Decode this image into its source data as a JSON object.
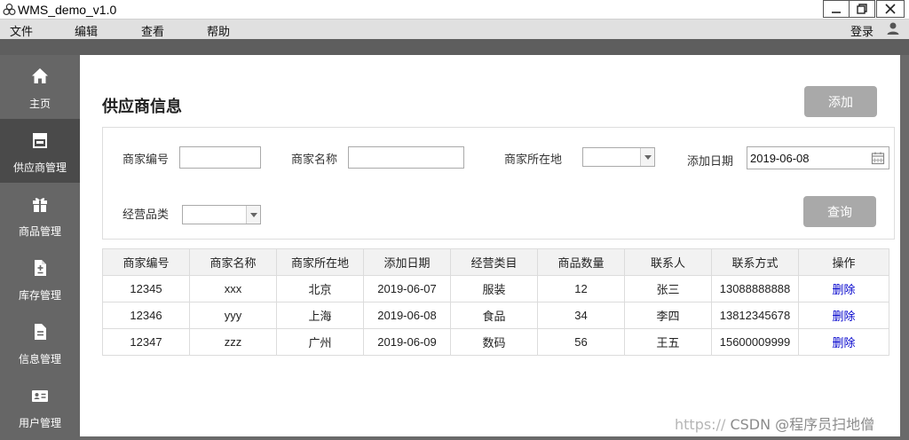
{
  "window": {
    "title": "WMS_demo_v1.0"
  },
  "menu": {
    "items": [
      "文件",
      "编辑",
      "查看",
      "帮助"
    ],
    "login": "登录"
  },
  "sidebar": {
    "items": [
      {
        "label": "主页",
        "icon": "home-icon",
        "active": false
      },
      {
        "label": "供应商管理",
        "icon": "store-icon",
        "active": true
      },
      {
        "label": "商品管理",
        "icon": "gift-icon",
        "active": false
      },
      {
        "label": "库存管理",
        "icon": "inventory-doc-icon",
        "active": false
      },
      {
        "label": "信息管理",
        "icon": "document-icon",
        "active": false
      },
      {
        "label": "用户管理",
        "icon": "id-card-icon",
        "active": false
      }
    ]
  },
  "main": {
    "title": "供应商信息",
    "add_label": "添加",
    "query_label": "查询"
  },
  "filters": {
    "merchant_id_label": "商家编号",
    "merchant_id_value": "",
    "merchant_name_label": "商家名称",
    "merchant_name_value": "",
    "location_label": "商家所在地",
    "location_value": "",
    "date_label": "添加日期",
    "date_value": "2019-06-08",
    "category_label": "经营品类",
    "category_value": ""
  },
  "table": {
    "headers": [
      "商家编号",
      "商家名称",
      "商家所在地",
      "添加日期",
      "经营类目",
      "商品数量",
      "联系人",
      "联系方式",
      "操作"
    ],
    "rows": [
      [
        "12345",
        "xxx",
        "北京",
        "2019-06-07",
        "服装",
        "12",
        "张三",
        "13088888888",
        "删除"
      ],
      [
        "12346",
        "yyy",
        "上海",
        "2019-06-08",
        "食品",
        "34",
        "李四",
        "13812345678",
        "删除"
      ],
      [
        "12347",
        "zzz",
        "广州",
        "2019-06-09",
        "数码",
        "56",
        "王五",
        "15600009999",
        "删除"
      ]
    ]
  },
  "watermark": {
    "prefix": "https://",
    "text": "CSDN @程序员扫地僧"
  },
  "colors": {
    "sidebar_bg": "#666666",
    "sidebar_active": "#4a4a4a",
    "button_gray": "#a9a9a9",
    "link_blue": "#0000cc"
  }
}
